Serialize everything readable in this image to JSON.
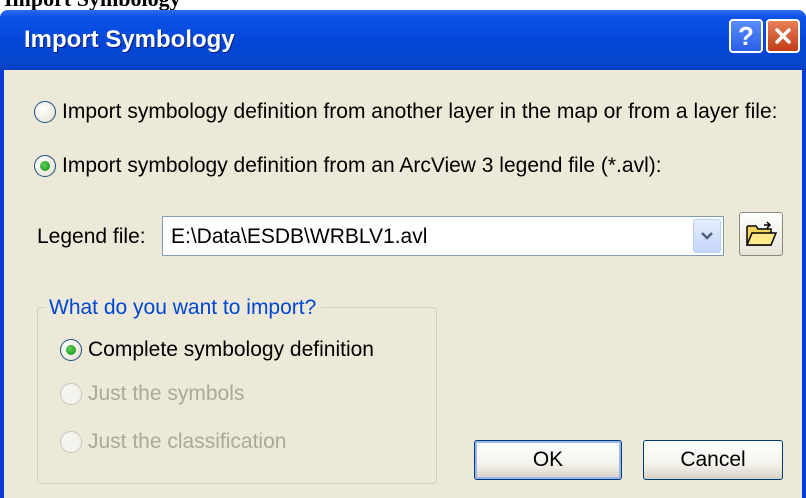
{
  "top_text": "Import Symbology",
  "window": {
    "title": "Import Symbology",
    "help_button": "?",
    "close_button": "close"
  },
  "source": {
    "option_layer": "Import symbology definition from another layer in the map or from a layer file:",
    "option_avl": "Import symbology definition from an ArcView 3 legend file (*.avl):",
    "selected": "avl"
  },
  "legend_file": {
    "label": "Legend file:",
    "value": "E:\\Data\\ESDB\\WRBLV1.avl",
    "browse_icon": "open-folder-icon"
  },
  "import_group": {
    "title": "What do you want to import?",
    "options": [
      {
        "label": "Complete symbology definition",
        "selected": true,
        "enabled": true
      },
      {
        "label": "Just the symbols",
        "selected": false,
        "enabled": false
      },
      {
        "label": "Just the classification",
        "selected": false,
        "enabled": false
      }
    ]
  },
  "buttons": {
    "ok": "OK",
    "cancel": "Cancel"
  },
  "colors": {
    "titlebar": "#0347d8",
    "dialog_bg": "#ece9d8",
    "group_title": "#0046d5",
    "radio_dot": "#21a121",
    "disabled_text": "#aca899"
  }
}
